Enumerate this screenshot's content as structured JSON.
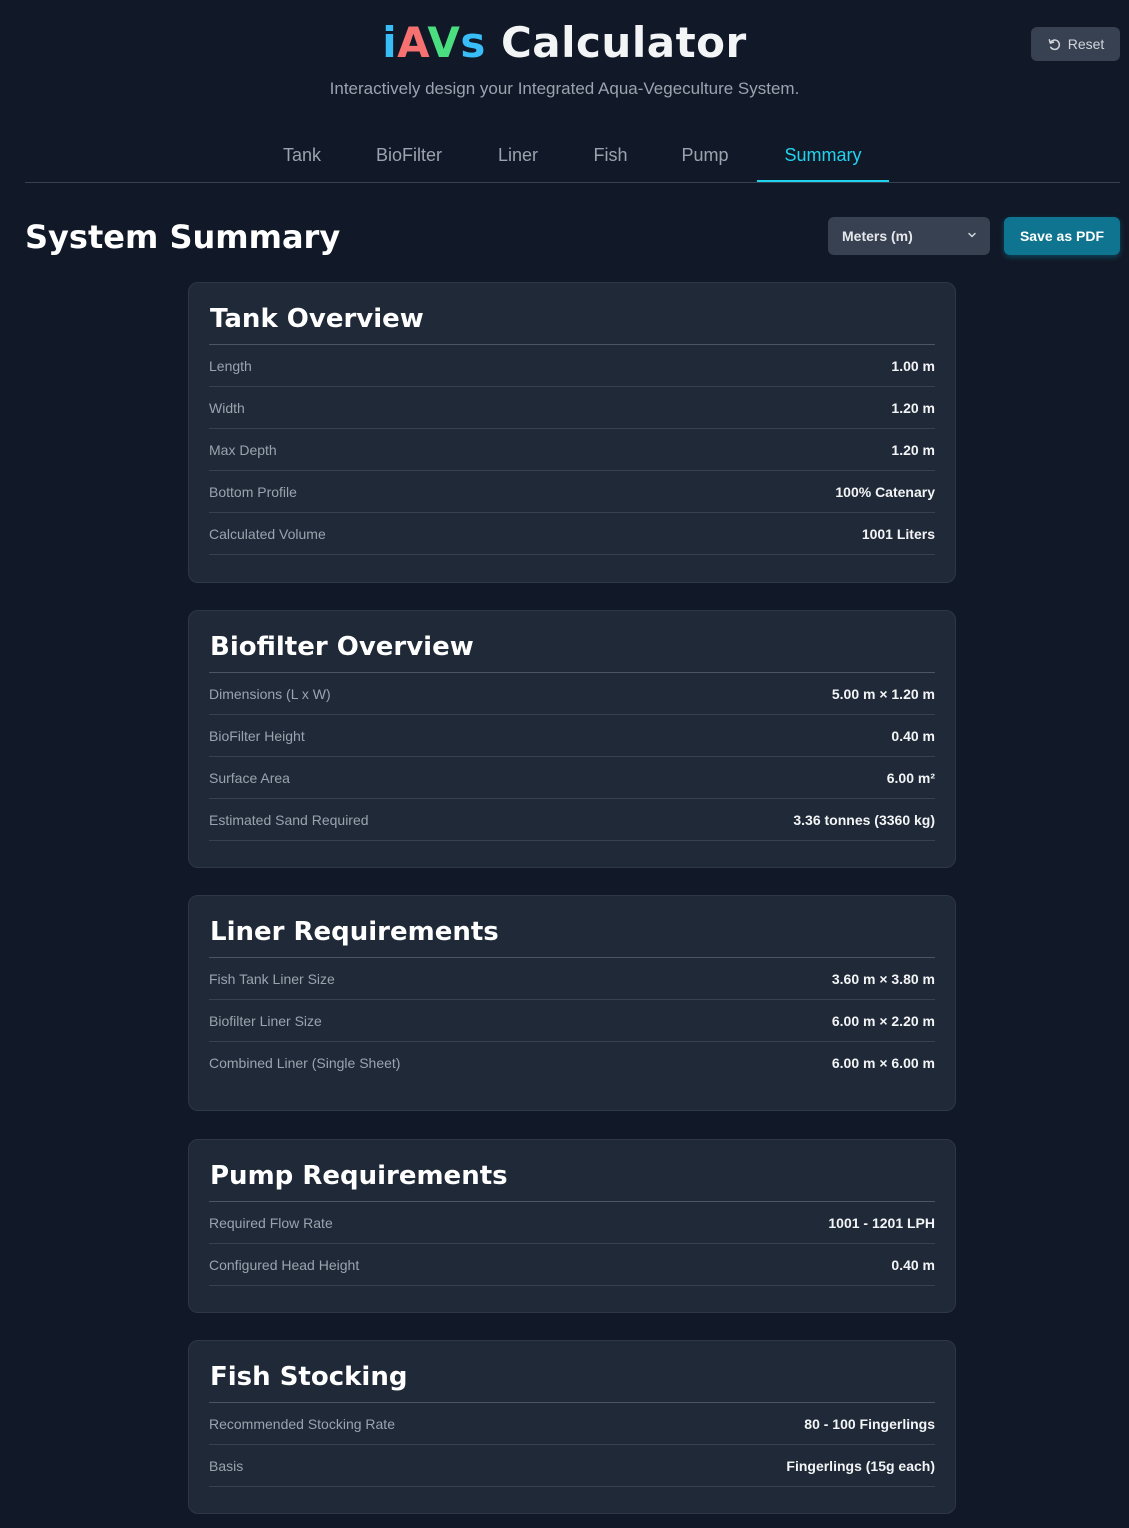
{
  "header": {
    "title_part_i": "i",
    "title_part_a": "A",
    "title_part_v": "V",
    "title_part_s": "s",
    "title_rest": " Calculator",
    "subtitle": "Interactively design your Integrated Aqua-Vegeculture System.",
    "reset_label": "Reset"
  },
  "tabs": [
    "Tank",
    "BioFilter",
    "Liner",
    "Fish",
    "Pump",
    "Summary"
  ],
  "active_tab": "Summary",
  "summary": {
    "title": "System Summary",
    "unit_select": "Meters (m)",
    "pdf_label": "Save as PDF"
  },
  "cards": [
    {
      "title": "Tank Overview",
      "rows": [
        {
          "label": "Length",
          "value": "1.00 m"
        },
        {
          "label": "Width",
          "value": "1.20 m"
        },
        {
          "label": "Max Depth",
          "value": "1.20 m"
        },
        {
          "label": "Bottom Profile",
          "value": "100% Catenary"
        },
        {
          "label": "Calculated Volume",
          "value": "1001 Liters"
        }
      ]
    },
    {
      "title": "Biofilter Overview",
      "rows": [
        {
          "label": "Dimensions (L x W)",
          "value": "5.00 m × 1.20 m"
        },
        {
          "label": "BioFilter Height",
          "value": "0.40 m"
        },
        {
          "label": "Surface Area",
          "value": "6.00 m²"
        },
        {
          "label": "Estimated Sand Required",
          "value": "3.36 tonnes (3360 kg)"
        }
      ]
    },
    {
      "title": "Liner Requirements",
      "rows": [
        {
          "label": "Fish Tank Liner Size",
          "value": "3.60 m × 3.80 m"
        },
        {
          "label": "Biofilter Liner Size",
          "value": "6.00 m × 2.20 m"
        },
        {
          "label": "Combined Liner (Single Sheet)",
          "value": "6.00 m × 6.00 m"
        }
      ]
    },
    {
      "title": "Pump Requirements",
      "rows": [
        {
          "label": "Required Flow Rate",
          "value": "1001 - 1201 LPH"
        },
        {
          "label": "Configured Head Height",
          "value": "0.40 m"
        }
      ]
    },
    {
      "title": "Fish Stocking",
      "rows": [
        {
          "label": "Recommended Stocking Rate",
          "value": "80 - 100 Fingerlings"
        },
        {
          "label": "Basis",
          "value": "Fingerlings (15g each)"
        }
      ]
    }
  ]
}
